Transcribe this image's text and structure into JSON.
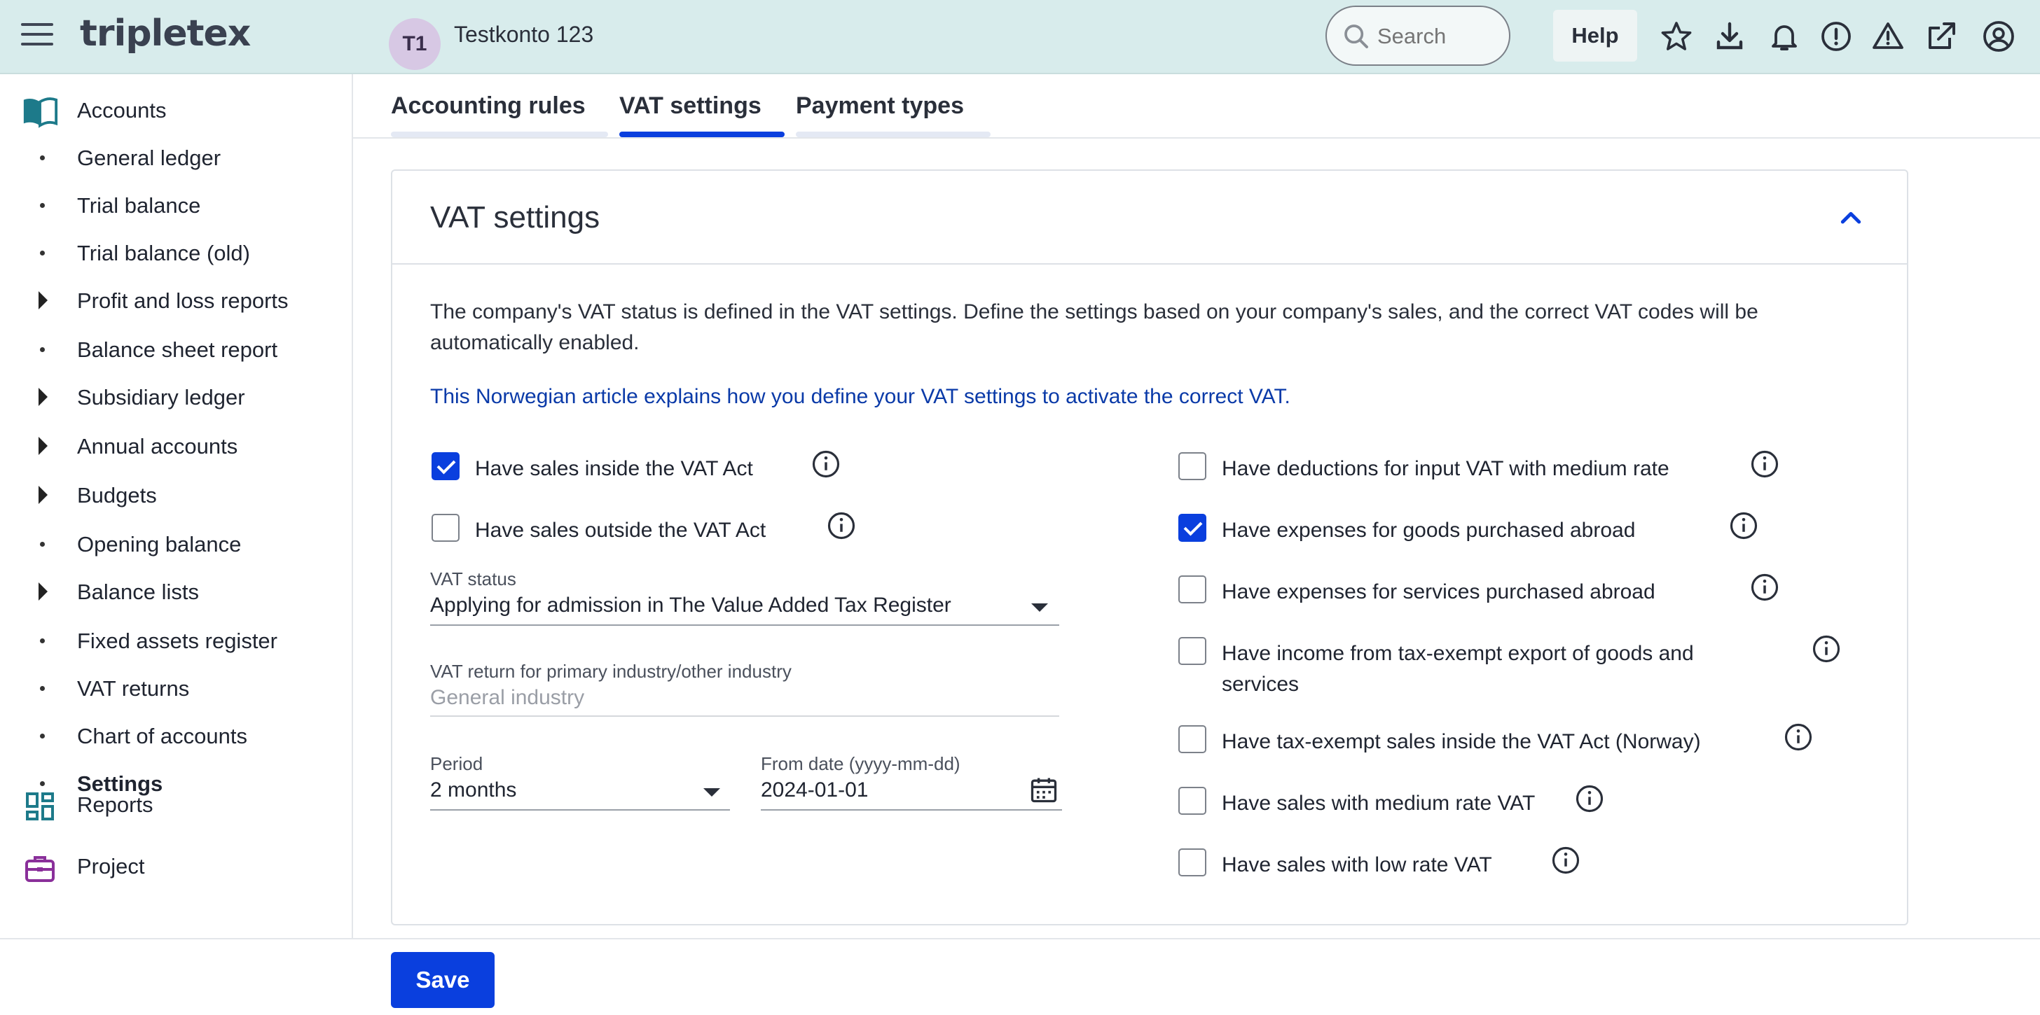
{
  "header": {
    "logo": "tripletex",
    "avatar_initials": "T1",
    "account_name": "Testkonto 123",
    "search_placeholder": "Search",
    "help_label": "Help",
    "icons": [
      "star-icon",
      "download-icon",
      "bell-icon",
      "alert-circle-icon",
      "warning-icon",
      "external-link-icon",
      "user-circle-icon"
    ]
  },
  "sidebar": {
    "accounts_label": "Accounts",
    "items": [
      {
        "label": "General ledger",
        "type": "bullet"
      },
      {
        "label": "Trial balance",
        "type": "bullet"
      },
      {
        "label": "Trial balance (old)",
        "type": "bullet"
      },
      {
        "label": "Profit and loss reports",
        "type": "arrow"
      },
      {
        "label": "Balance sheet report",
        "type": "bullet"
      },
      {
        "label": "Subsidiary ledger",
        "type": "arrow"
      },
      {
        "label": "Annual accounts",
        "type": "arrow"
      },
      {
        "label": "Budgets",
        "type": "arrow"
      },
      {
        "label": "Opening balance",
        "type": "bullet"
      },
      {
        "label": "Balance lists",
        "type": "arrow"
      },
      {
        "label": "Fixed assets register",
        "type": "bullet"
      },
      {
        "label": "VAT returns",
        "type": "bullet"
      },
      {
        "label": "Chart of accounts",
        "type": "bullet"
      },
      {
        "label": "Settings",
        "type": "bullet",
        "active": true
      }
    ],
    "reports_label": "Reports",
    "project_label": "Project"
  },
  "tabs": [
    {
      "label": "Accounting rules",
      "active": false
    },
    {
      "label": "VAT settings",
      "active": true
    },
    {
      "label": "Payment types",
      "active": false
    }
  ],
  "card": {
    "title": "VAT settings",
    "description": "The company's VAT status is defined in the VAT settings. Define the settings based on your company's sales, and the correct VAT codes will be automatically enabled.",
    "link_text": "This Norwegian article explains how you define your VAT settings to activate the correct VAT.",
    "left_checkboxes": [
      {
        "label": "Have sales inside the VAT Act",
        "checked": true
      },
      {
        "label": "Have sales outside the VAT Act",
        "checked": false
      }
    ],
    "vat_status": {
      "label": "VAT status",
      "value": "Applying for admission in The Value Added Tax Register"
    },
    "vat_return": {
      "label": "VAT return for primary industry/other industry",
      "value": "General industry"
    },
    "period": {
      "label": "Period",
      "value": "2 months"
    },
    "from_date": {
      "label": "From date (yyyy-mm-dd)",
      "value": "2024-01-01"
    },
    "right_checkboxes": [
      {
        "label": "Have deductions for input VAT with medium rate",
        "checked": false
      },
      {
        "label": "Have expenses for goods purchased abroad",
        "checked": true
      },
      {
        "label": "Have expenses for services purchased abroad",
        "checked": false
      },
      {
        "label": "Have income from tax-exempt export of goods and services",
        "checked": false
      },
      {
        "label": "Have tax-exempt sales inside the VAT Act (Norway)",
        "checked": false
      },
      {
        "label": "Have sales with medium rate VAT",
        "checked": false
      },
      {
        "label": "Have sales with low rate VAT",
        "checked": false
      }
    ]
  },
  "footer": {
    "save_label": "Save"
  },
  "colors": {
    "header_bg": "#d8ecec",
    "primary": "#0a3fde",
    "link": "#0a3aa8"
  }
}
